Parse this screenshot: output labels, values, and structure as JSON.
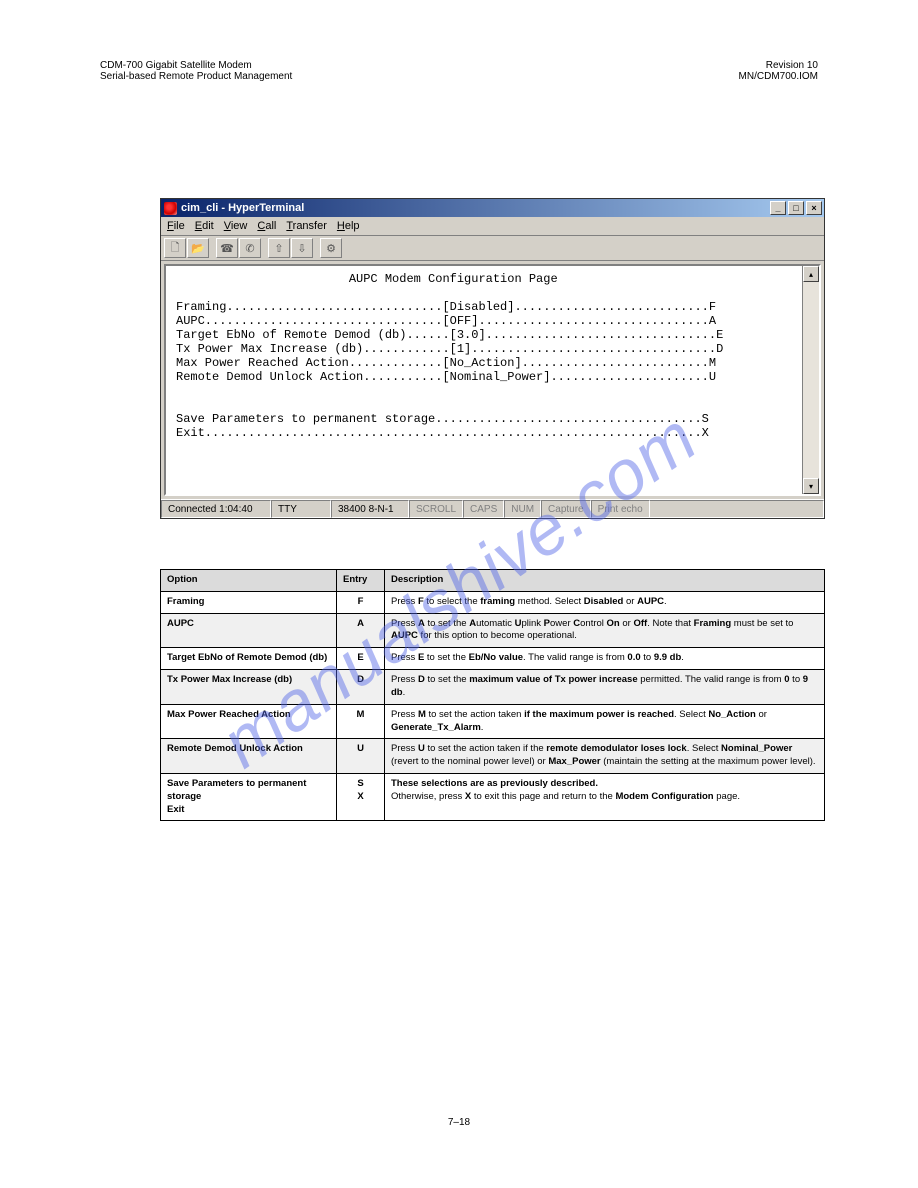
{
  "header": {
    "left": "CDM-700 Gigabit Satellite Modem",
    "right": "Revision 10",
    "sub_left": "Serial-based Remote Product Management",
    "sub_right": "MN/CDM700.IOM"
  },
  "window": {
    "title": "cim_cli - HyperTerminal",
    "buttons": {
      "min": "_",
      "max": "□",
      "close": "×"
    }
  },
  "menubar": [
    "File",
    "Edit",
    "View",
    "Call",
    "Transfer",
    "Help"
  ],
  "toolbar_icons": [
    "new-doc-icon",
    "open-icon",
    "phone-icon",
    "hangup-icon",
    "send-icon",
    "receive-icon",
    "properties-icon"
  ],
  "terminal": {
    "title": "AUPC Modem Configuration Page",
    "lines": [
      {
        "label": "Framing",
        "pad1": 30,
        "val": "Disabled",
        "pad2": 27,
        "key": "F"
      },
      {
        "label": "AUPC",
        "pad1": 33,
        "val": "OFF",
        "pad2": 32,
        "key": "A"
      },
      {
        "label": "Target EbNo of Remote Demod (db)",
        "pad1": 6,
        "val": "3.0",
        "pad2": 32,
        "key": "E"
      },
      {
        "label": "Tx Power Max Increase (db)",
        "pad1": 12,
        "val": "1",
        "pad2": 34,
        "key": "D"
      },
      {
        "label": "Max Power Reached Action",
        "pad1": 13,
        "val": "No_Action",
        "pad2": 26,
        "key": "M"
      },
      {
        "label": "Remote Demod Unlock Action",
        "pad1": 11,
        "val": "Nominal_Power",
        "pad2": 22,
        "key": "U"
      }
    ],
    "tail": [
      {
        "label": "Save Parameters to permanent storage",
        "pad": 37,
        "key": "S"
      },
      {
        "label": "Exit",
        "pad": 69,
        "key": "X"
      }
    ]
  },
  "statusbar": {
    "connected": "Connected 1:04:40",
    "emu": "TTY",
    "port": "38400 8-N-1",
    "flags": [
      "SCROLL",
      "CAPS",
      "NUM",
      "Capture",
      "Print echo"
    ]
  },
  "table": {
    "headers": [
      "Option",
      "Entry",
      "Description"
    ],
    "rows": [
      {
        "option": "Framing",
        "entry": "F",
        "desc": "Press <b>F</b> to select the <b>framing</b> method. Select <b>Disabled</b> or <b>AUPC</b>."
      },
      {
        "option": "AUPC",
        "entry": "A",
        "desc": "Press <b>A</b> to set the <b>A</b>utomatic <b>U</b>plink <b>P</b>ower <b>C</b>ontrol <b>On</b> or <b>Off</b>. Note that <b>Framing</b> must be set to <b>AUPC</b> for this option to become operational."
      },
      {
        "option": "Target EbNo of Remote Demod (db)",
        "entry": "E",
        "desc": "Press <b>E</b> to set the <b>Eb/No value</b>. The valid range is from <b>0.0</b> to <b>9.9 db</b>."
      },
      {
        "option": "Tx Power Max Increase (db)",
        "entry": "D",
        "desc": "Press <b>D</b> to set the <b>maximum value of Tx power increase</b> permitted. The valid range is from <b>0</b> to <b>9 db</b>."
      },
      {
        "option": "Max Power Reached Action",
        "entry": "M",
        "desc": "Press <b>M</b> to set the action taken <b>if the maximum power is reached</b>. Select <b>No_Action</b> or <b>Generate_Tx_Alarm</b>."
      },
      {
        "option": "Remote Demod Unlock Action",
        "entry": "U",
        "desc": "Press <b>U</b> to set the action taken if the <b>remote demodulator loses lock</b>. Select <b>Nominal_Power</b> (revert to the nominal power level) or <b>Max_Power</b> (maintain the setting at the maximum power level)."
      },
      {
        "option": "Save Parameters to permanent storage<br>Exit",
        "entry": "S<br>X",
        "cont_head": "These selections are as previously described.",
        "cont_body": "Otherwise, press <b>X</b> to exit this page and return to the <b>Modem Configuration</b> page."
      }
    ]
  },
  "watermark": "manualshive.com",
  "page_number": "7–18"
}
